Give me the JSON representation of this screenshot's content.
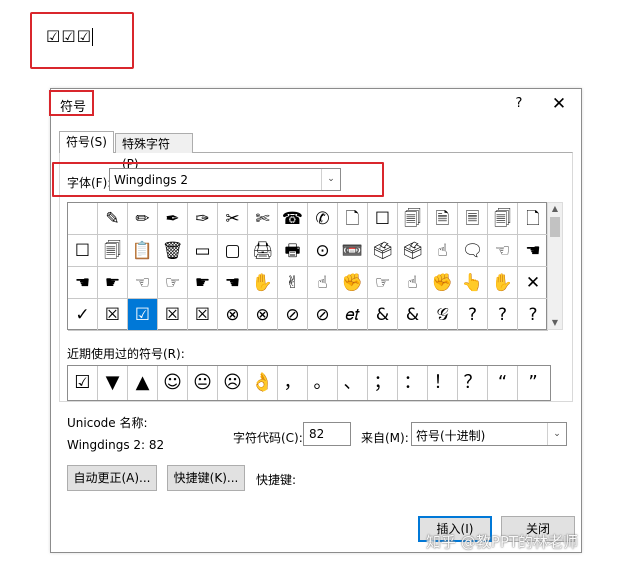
{
  "document": {
    "text": "☑☑☑"
  },
  "dialog": {
    "title": "符号",
    "help": "?",
    "close": "✕",
    "tabs": [
      {
        "label": "符号(S)"
      },
      {
        "label": "特殊字符(P)"
      }
    ],
    "font": {
      "label": "字体(F):",
      "value": "Wingdings 2",
      "arrow": "⌄"
    },
    "grid": [
      [
        "",
        "✎",
        "✏",
        "✒",
        "✑",
        "✂",
        "✄",
        "☎",
        "✆",
        "🗋",
        "☐",
        "🗐",
        "🗎",
        "🗏",
        "🗐",
        "🗋"
      ],
      [
        "☐",
        "🗐",
        "📋",
        "🗑",
        "▭",
        "▢",
        "🖨",
        "🖶",
        "⊙",
        "📼",
        "🗳",
        "🗳",
        "☝",
        "🗨",
        "☜",
        "☚"
      ],
      [
        "☚",
        "☛",
        "☜",
        "☞",
        "☛",
        "☚",
        "✋",
        "✌",
        "☝",
        "✊",
        "☞",
        "☝",
        "✊",
        "👆",
        "✋",
        "✕"
      ],
      [
        "✓",
        "☒",
        "☑",
        "☒",
        "☒",
        "⊗",
        "⊗",
        "⊘",
        "⊘",
        "𝑒𝑡",
        "&",
        "&",
        "𝒢",
        "?",
        "?",
        "?"
      ]
    ],
    "selected_cell": "3-2",
    "scrollbar": {
      "up": "▲",
      "down": "▼"
    },
    "recent": {
      "label": "近期使用过的符号(R):",
      "symbols": [
        "☑",
        "▼",
        "▲",
        "☺",
        "😐",
        "☹",
        "👌",
        "，",
        "。",
        "、",
        "；",
        "：",
        "！",
        "？",
        "“",
        "”"
      ]
    },
    "unicode": {
      "label": "Unicode 名称:",
      "value": "Wingdings 2: 82"
    },
    "char_code": {
      "label": "字符代码(C):",
      "value": "82"
    },
    "from": {
      "label": "来自(M):",
      "value": "符号(十进制)",
      "arrow": "⌄"
    },
    "buttons": {
      "autocorrect": "自动更正(A)...",
      "shortcut_key": "快捷键(K)...",
      "shortcut_label": "快捷键:",
      "insert": "插入(I)",
      "close": "关闭"
    }
  },
  "watermark": "知乎 @教PPT的林老师",
  "colors": {
    "highlight": "#d9262c",
    "selection": "#0078d7"
  }
}
